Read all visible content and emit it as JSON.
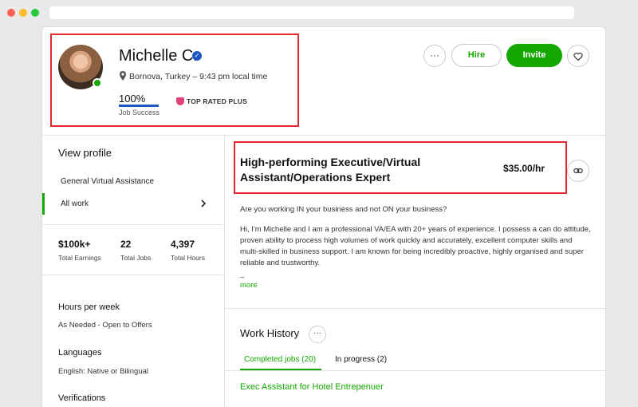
{
  "profile": {
    "name": "Michelle C.",
    "location": "Bornova, Turkey – 9:43 pm local time",
    "job_success_value": "100%",
    "job_success_label": "Job Success",
    "job_success_fraction": 1.0,
    "badge": "TOP RATED PLUS"
  },
  "actions": {
    "more": "···",
    "hire": "Hire",
    "invite": "Invite"
  },
  "sidebar": {
    "view_profile": "View profile",
    "specializations": [
      "General Virtual Assistance",
      "All work"
    ],
    "stats": [
      {
        "value": "$100k+",
        "label": "Total Earnings"
      },
      {
        "value": "22",
        "label": "Total Jobs"
      },
      {
        "value": "4,397",
        "label": "Total Hours"
      }
    ],
    "hours_heading": "Hours per week",
    "hours_value": "As Needed - Open to Offers",
    "languages_heading": "Languages",
    "languages_value": "English: Native or Bilingual",
    "verifications_heading": "Verifications"
  },
  "main": {
    "title": "High-performing Executive/Virtual Assistant/Operations Expert",
    "rate": "$35.00/hr",
    "paragraph1": "Are you working IN your business and not ON your business?",
    "paragraph2": "Hi, I'm Michelle and I am a professional VA/EA with 20+ years of experience. I possess a can do attitude, proven ability to process high volumes of work quickly and accurately, excellent computer skills and multi-skilled in business support. I am known for being incredibly proactive, highly organised and super reliable and trustworthy.",
    "ellipsis": "_",
    "more": "more"
  },
  "work_history": {
    "title": "Work History",
    "more": "···",
    "tabs": [
      "Completed jobs (20)",
      "In progress (2)"
    ],
    "first_job": "Exec Assistant for Hotel Entrepenuer"
  },
  "colors": {
    "accent": "#14a800",
    "highlight": "#e0282f",
    "verified": "#1f57c3"
  }
}
